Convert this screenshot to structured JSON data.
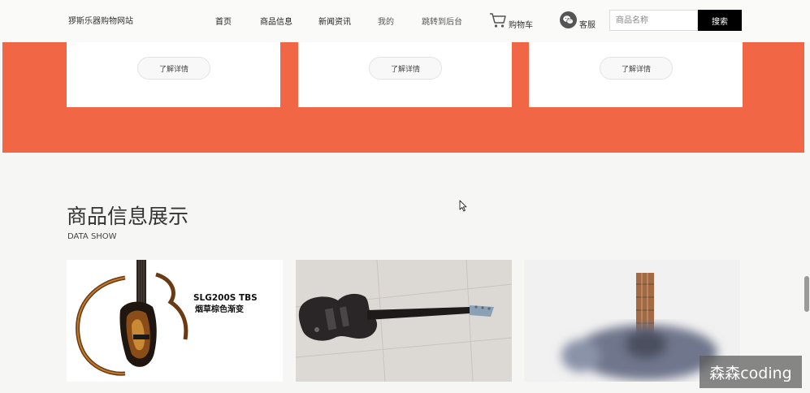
{
  "header": {
    "brand": "猡斯乐器购物网站",
    "nav": [
      "首页",
      "商品信息",
      "新闻资讯",
      "我的",
      "跳转到后台"
    ],
    "cart_label": "购物车",
    "service_label": "客服",
    "search_placeholder": "商品名称",
    "search_button": "搜索"
  },
  "feature_cards": [
    {
      "button": "了解详情"
    },
    {
      "button": "了解详情"
    },
    {
      "button": "了解详情"
    }
  ],
  "section": {
    "title": "商品信息展示",
    "subtitle": "DATA SHOW"
  },
  "products": [
    {
      "image_text_line1": "SLG200S TBS",
      "image_text_line2": "烟草棕色渐变"
    },
    {},
    {}
  ],
  "watermark": "森森coding",
  "colors": {
    "accent_orange": "#f16645",
    "search_button_bg": "#000000"
  }
}
